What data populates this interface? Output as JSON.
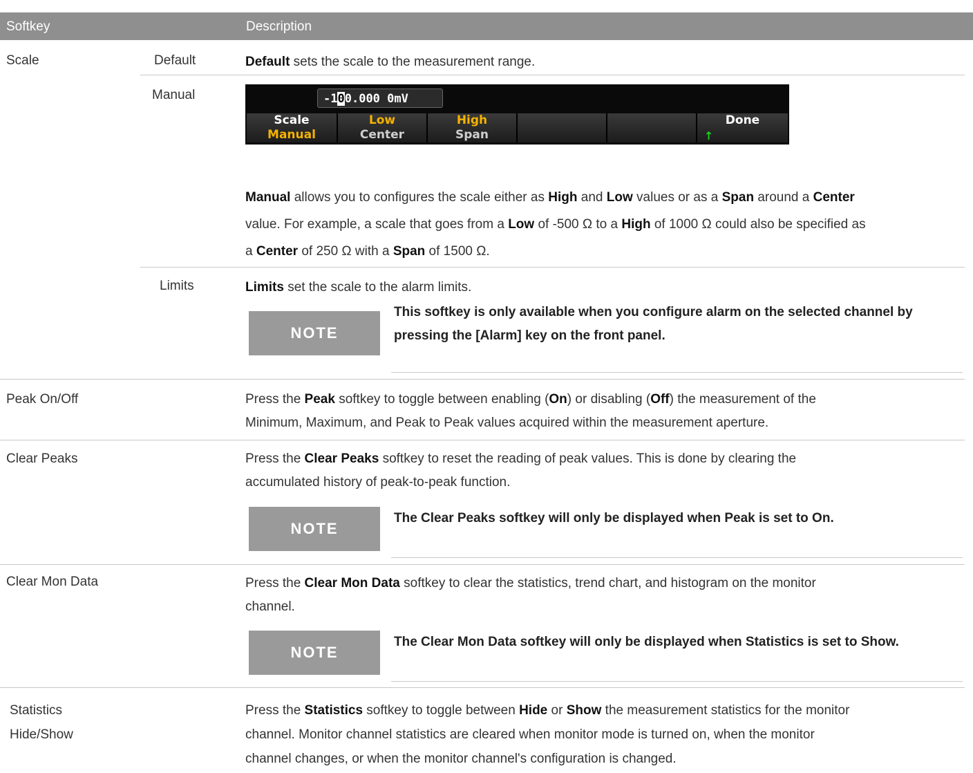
{
  "header": {
    "col1": "Softkey",
    "col2": "Description"
  },
  "scale": {
    "label": "Scale",
    "default": {
      "label": "Default",
      "desc_bold": "Default",
      "desc_rest": " sets the scale to the measurement range."
    },
    "manual": {
      "label": "Manual",
      "panel": {
        "readout_a": "-1",
        "readout_cursor": "0",
        "readout_b": "0.000 0mV",
        "keys": [
          {
            "top": "Scale",
            "bottom": "Manual"
          },
          {
            "top": "Low",
            "bottom": "Center"
          },
          {
            "top": "High",
            "bottom": "Span"
          },
          {
            "top": "",
            "bottom": ""
          },
          {
            "top": "",
            "bottom": ""
          },
          {
            "top": "Done",
            "bottom": ""
          }
        ],
        "done_arrow": "↑"
      },
      "p1": [
        "Manual",
        " allows you to configures the scale either as ",
        "High",
        " and ",
        "Low",
        " values or as a ",
        "Span",
        " around a ",
        "Center"
      ],
      "p2": [
        "value. For example, a scale that goes from a ",
        "Low",
        " of -500 Ω to a ",
        "High",
        " of 1000 Ω could also be specified as"
      ],
      "p3": [
        "a ",
        "Center",
        " of 250 Ω with a ",
        "Span",
        " of 1500 Ω."
      ]
    },
    "limits": {
      "label": "Limits",
      "desc_bold": "Limits",
      "desc_rest": " set the scale to the alarm limits.",
      "note_label": "NOTE",
      "note_line1": "This softkey is only available when you configure alarm on the selected channel by",
      "note_line2": "pressing the [Alarm] key on the front panel."
    }
  },
  "peak": {
    "label": "Peak On/Off",
    "l1": [
      "Press the ",
      "Peak",
      " softkey to toggle between enabling (",
      "On",
      ") or disabling (",
      "Off",
      ") the measurement of the"
    ],
    "l2": "Minimum, Maximum, and Peak to Peak values acquired within the measurement aperture."
  },
  "clear_peaks": {
    "label": "Clear Peaks",
    "l1": [
      "Press the ",
      "Clear Peaks",
      " softkey to reset the reading of peak values. This is done by clearing the"
    ],
    "l2": "accumulated history of peak-to-peak function.",
    "note_label": "NOTE",
    "note": "The Clear Peaks softkey will only be displayed when Peak is set to On."
  },
  "clear_mon": {
    "label": "Clear Mon Data",
    "l1": [
      "Press the ",
      "Clear Mon Data",
      " softkey to clear the statistics, trend chart, and histogram on the monitor"
    ],
    "l2": "channel.",
    "note_label": "NOTE",
    "note": "The Clear Mon Data softkey will only be displayed when Statistics is set to Show."
  },
  "statistics": {
    "label1": "Statistics",
    "label2": "Hide/Show",
    "l1": [
      "Press the ",
      "Statistics",
      " softkey to toggle between ",
      "Hide",
      " or ",
      "Show",
      " the measurement statistics for the monitor"
    ],
    "l2": "channel. Monitor channel statistics are cleared when monitor mode is turned on, when the monitor",
    "l3": "channel changes, or when the monitor channel's configuration is changed."
  }
}
